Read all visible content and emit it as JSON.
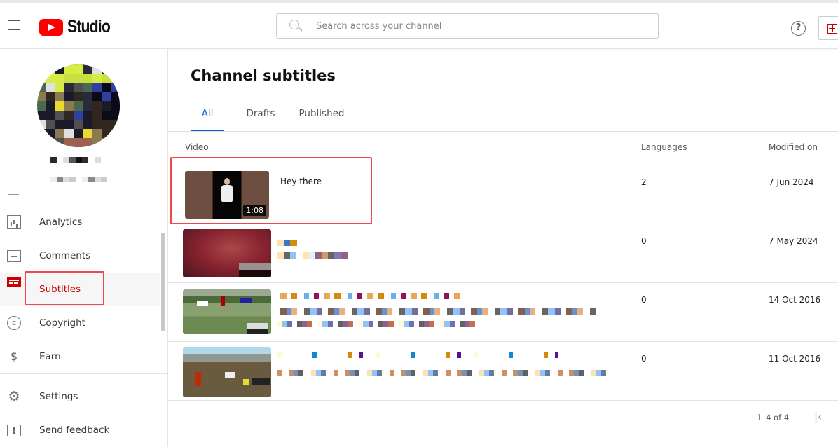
{
  "app": {
    "logo_text": "Studio",
    "search_placeholder": "Search across your channel",
    "help_glyph": "?",
    "icons": {
      "menu": "hamburger-icon",
      "search": "search-icon",
      "help": "help-icon",
      "create": "create-icon"
    }
  },
  "sidebar": {
    "channel_name": "",
    "items": [
      {
        "label": "Analytics",
        "icon": "analytics-icon"
      },
      {
        "label": "Comments",
        "icon": "comments-icon"
      },
      {
        "label": "Subtitles",
        "icon": "subtitles-icon",
        "active": true
      },
      {
        "label": "Copyright",
        "icon": "copyright-icon",
        "glyph": "c"
      },
      {
        "label": "Earn",
        "icon": "dollar-icon",
        "glyph": "$"
      }
    ],
    "bottom_items": [
      {
        "label": "Settings",
        "icon": "gear-icon",
        "glyph": "⚙"
      },
      {
        "label": "Send feedback",
        "icon": "feedback-icon",
        "glyph": "!"
      }
    ]
  },
  "main": {
    "title": "Channel subtitles",
    "tabs": [
      {
        "label": "All",
        "active": true
      },
      {
        "label": "Drafts"
      },
      {
        "label": "Published"
      }
    ],
    "columns": {
      "video": "Video",
      "languages": "Languages",
      "modified": "Modified on"
    },
    "rows": [
      {
        "title": "Hey there",
        "duration": "1:08",
        "languages": "2",
        "modified": "7 Jun 2024"
      },
      {
        "title": "",
        "duration": "",
        "languages": "0",
        "modified": "7 May 2024"
      },
      {
        "title": "",
        "duration": "",
        "languages": "0",
        "modified": "14 Oct 2016"
      },
      {
        "title": "",
        "duration": "",
        "languages": "0",
        "modified": "11 Oct 2016"
      }
    ],
    "pagination": "1–4 of 4",
    "first_page_glyph": "|‹"
  },
  "colors": {
    "accent": "#065fd4",
    "brand": "#ff0000",
    "active_nav": "#cc0000",
    "highlight": "#f04848"
  }
}
